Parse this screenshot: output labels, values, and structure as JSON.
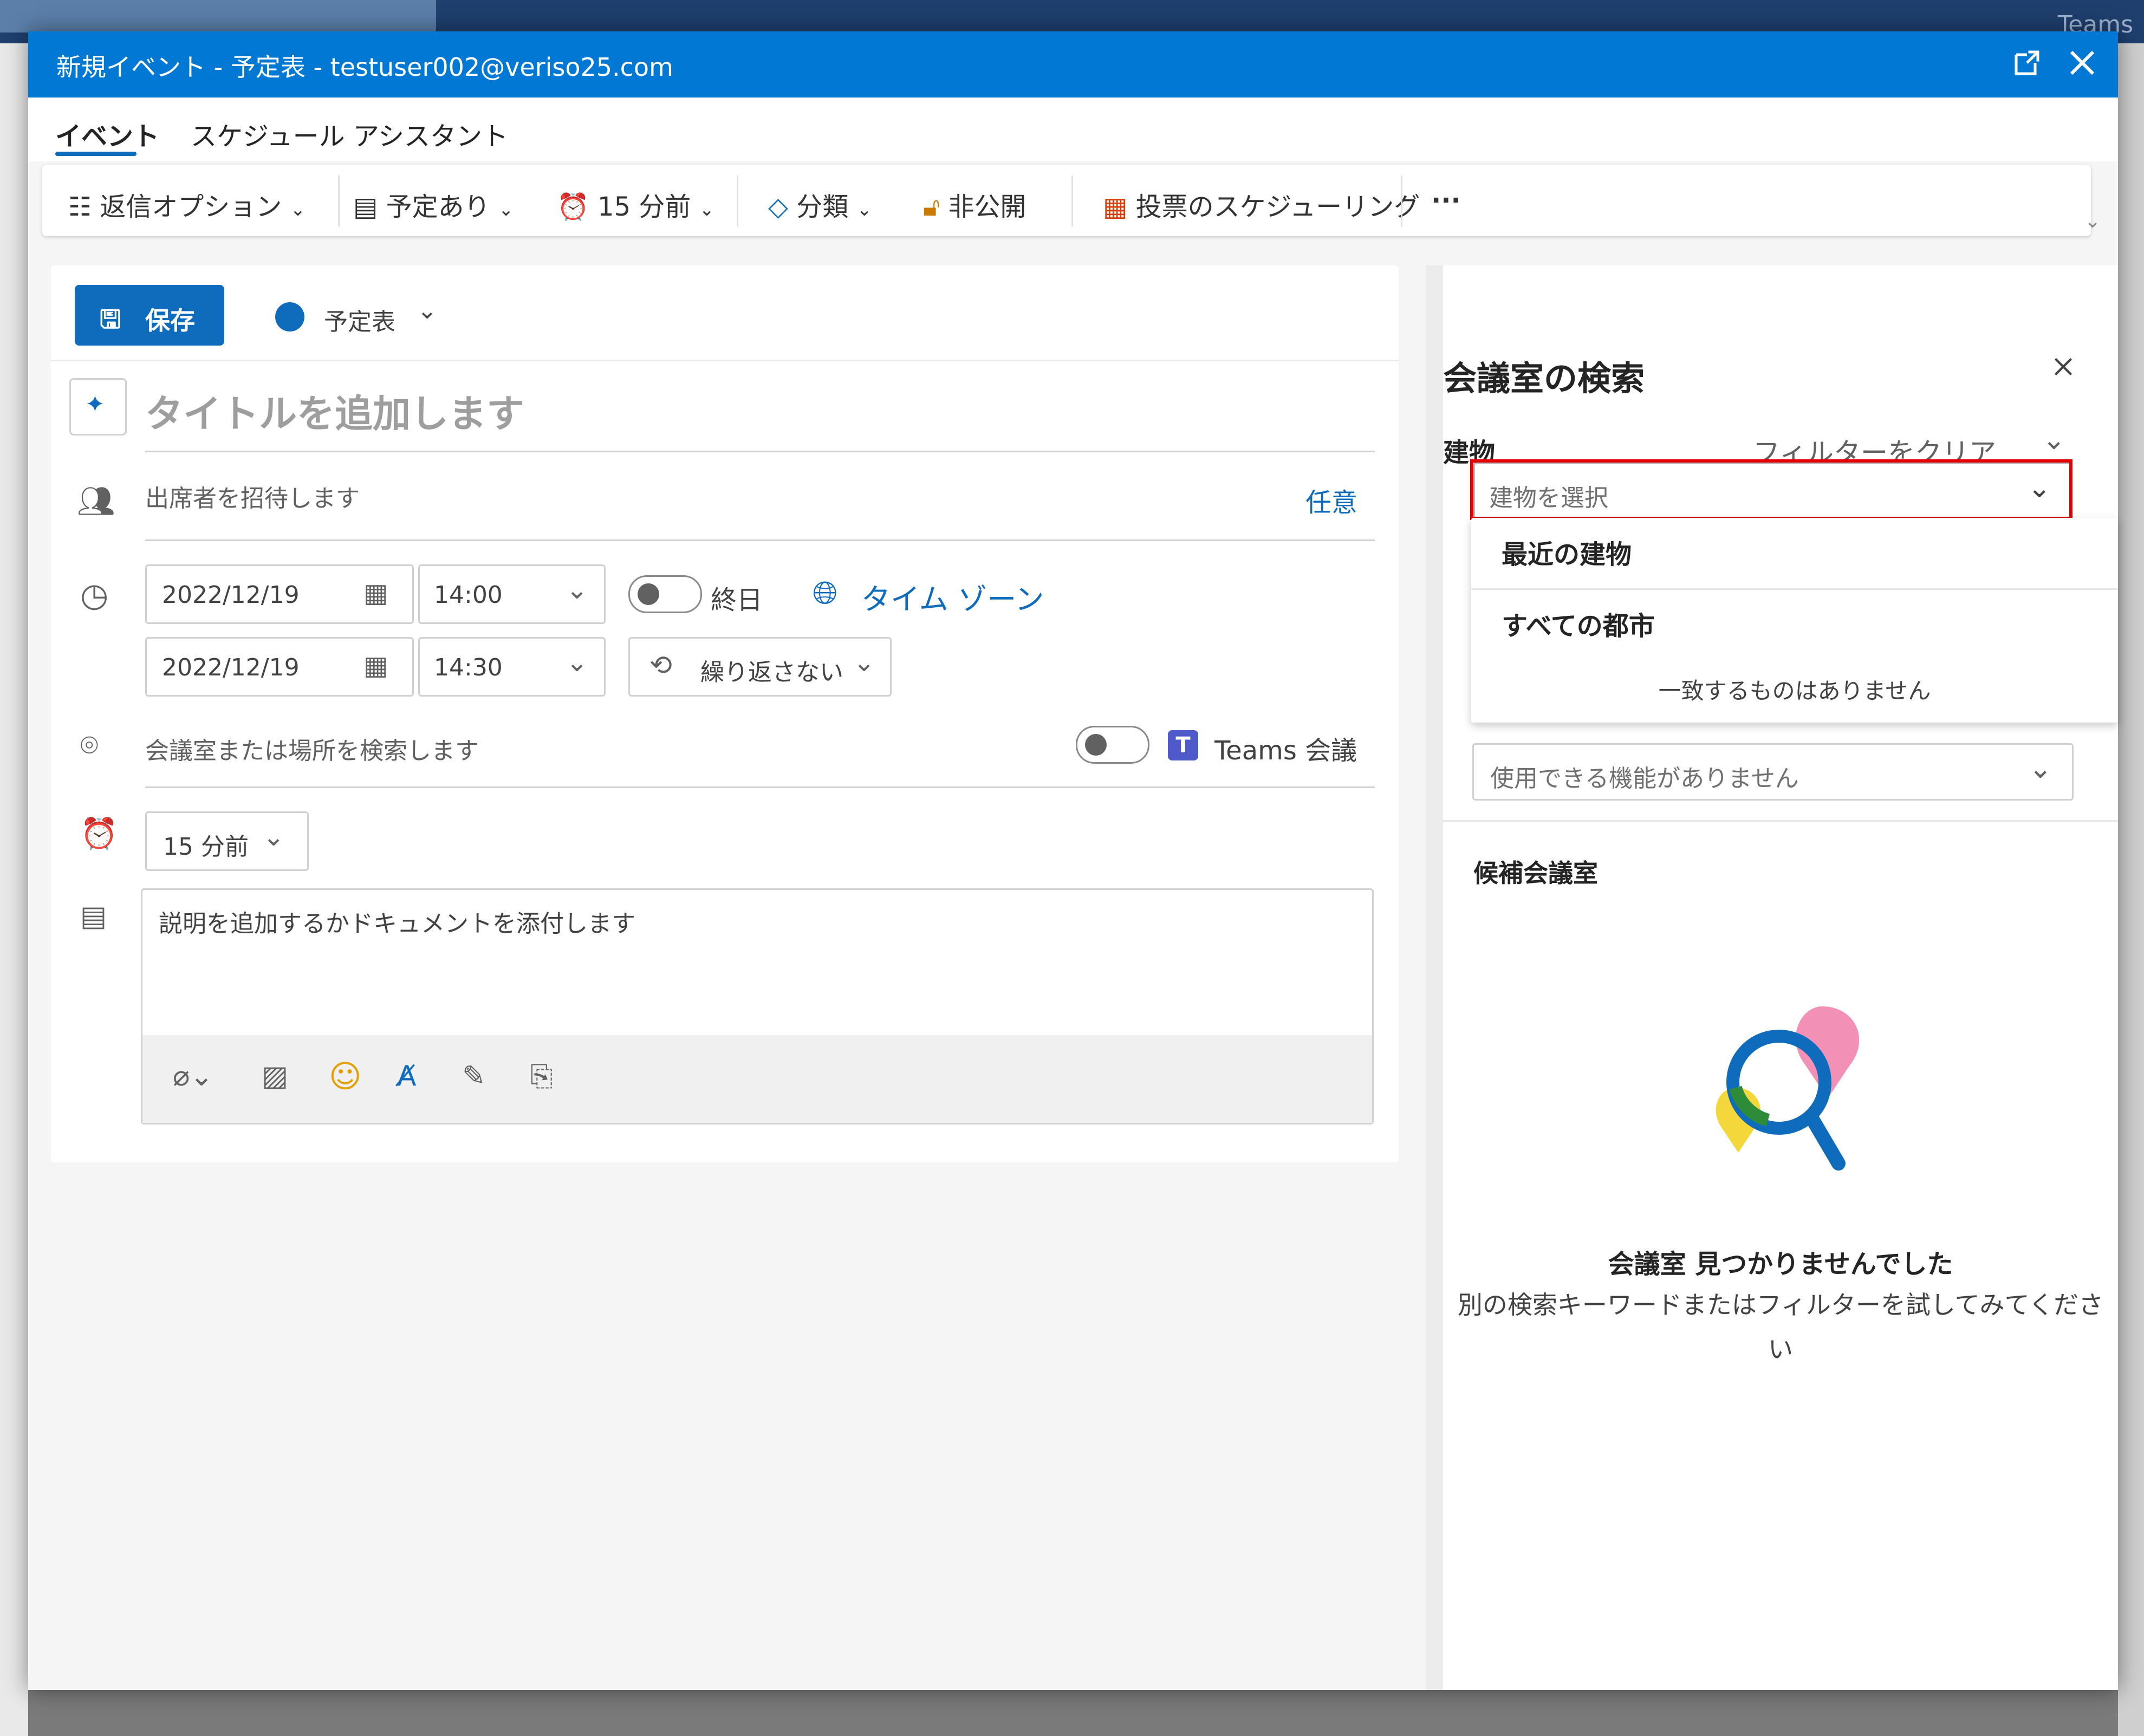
{
  "background": {
    "teams_label": "Teams"
  },
  "window": {
    "title": "新規イベント - 予定表 - testuser002@veriso25.com"
  },
  "tabs": [
    {
      "label": "イベント",
      "active": true
    },
    {
      "label": "スケジュール アシスタント",
      "active": false
    }
  ],
  "ribbon": {
    "reply_options": "返信オプション",
    "show_as": "予定あり",
    "reminder": "15 分前",
    "categorize": "分類",
    "private": "非公開",
    "scheduling_poll": "投票のスケジューリング",
    "more": "···"
  },
  "form": {
    "save_label": "保存",
    "calendar_label": "予定表",
    "title_placeholder": "タイトルを追加します",
    "attendees_placeholder": "出席者を招待します",
    "optional_label": "任意",
    "start_date": "2022/12/19",
    "start_time": "14:00",
    "end_date": "2022/12/19",
    "end_time": "14:30",
    "all_day_label": "終日",
    "timezone_label": "タイム ゾーン",
    "repeat_label": "繰り返さない",
    "location_placeholder": "会議室または場所を検索します",
    "teams_label": "Teams 会議",
    "reminder_value": "15 分前",
    "description_placeholder": "説明を追加するかドキュメントを添付します"
  },
  "room_finder": {
    "heading": "会議室の検索",
    "building_label": "建物",
    "clear_filter": "フィルターをクリア",
    "building_select_placeholder": "建物を選択",
    "dropdown": {
      "recent_buildings": "最近の建物",
      "all_cities": "すべての都市",
      "no_match": "一致するものはありません"
    },
    "features_placeholder": "使用できる機能がありません",
    "candidates_heading": "候補会議室",
    "empty_title": "会議室 見つかりませんでした",
    "empty_hint": "別の検索キーワードまたはフィルターを試してみてください"
  },
  "colors": {
    "accent": "#0f6cbd",
    "titlebar": "#0078d4",
    "highlight": "#e00000"
  }
}
